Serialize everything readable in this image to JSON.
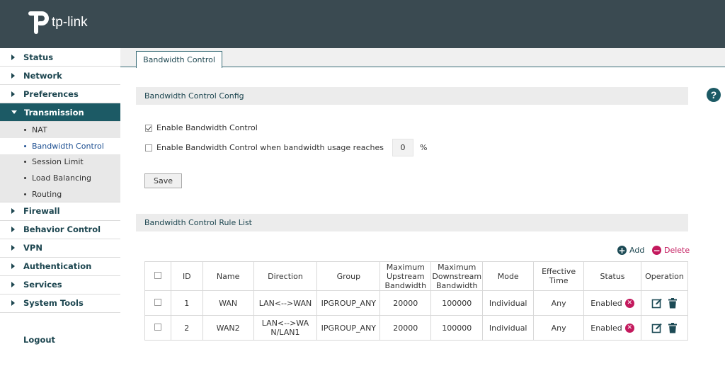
{
  "brand": {
    "logo_text": "tp-link"
  },
  "sidebar": {
    "items": [
      {
        "label": "Status"
      },
      {
        "label": "Network"
      },
      {
        "label": "Preferences"
      },
      {
        "label": "Transmission"
      },
      {
        "label": "Firewall"
      },
      {
        "label": "Behavior Control"
      },
      {
        "label": "VPN"
      },
      {
        "label": "Authentication"
      },
      {
        "label": "Services"
      },
      {
        "label": "System Tools"
      }
    ],
    "transmission_sub": [
      {
        "label": "NAT"
      },
      {
        "label": "Bandwidth Control"
      },
      {
        "label": "Session Limit"
      },
      {
        "label": "Load Balancing"
      },
      {
        "label": "Routing"
      }
    ],
    "logout": "Logout"
  },
  "tabs": [
    {
      "label": "Bandwidth Control"
    }
  ],
  "config": {
    "title": "Bandwidth Control Config",
    "enable_label": "Enable Bandwidth Control",
    "enable_checked": true,
    "enable_when_label": "Enable Bandwidth Control when bandwidth usage reaches",
    "enable_when_checked": false,
    "usage_value": "0",
    "usage_unit": "%",
    "save_label": "Save"
  },
  "rule_list": {
    "title": "Bandwidth Control Rule List",
    "add_label": "Add",
    "delete_label": "Delete",
    "columns": {
      "id": "ID",
      "name": "Name",
      "direction": "Direction",
      "group": "Group",
      "max_up": "Maximum Upstream Bandwidth",
      "max_down": "Maximum Downstream Bandwidth",
      "mode": "Mode",
      "effective_time": "Effective Time",
      "status": "Status",
      "operation": "Operation"
    },
    "rows": [
      {
        "id": "1",
        "name": "WAN",
        "direction": "LAN<-->WAN",
        "group": "IPGROUP_ANY",
        "max_up": "20000",
        "max_down": "100000",
        "mode": "Individual",
        "effective_time": "Any",
        "status": "Enabled"
      },
      {
        "id": "2",
        "name": "WAN2",
        "direction": "LAN<-->WAN/LAN1",
        "group": "IPGROUP_ANY",
        "max_up": "20000",
        "max_down": "100000",
        "mode": "Individual",
        "effective_time": "Any",
        "status": "Enabled"
      }
    ]
  },
  "colors": {
    "header_bg": "#3a4a51",
    "nav_active": "#1c5a65",
    "delete": "#c3195d",
    "link_active": "#1d4f91"
  }
}
